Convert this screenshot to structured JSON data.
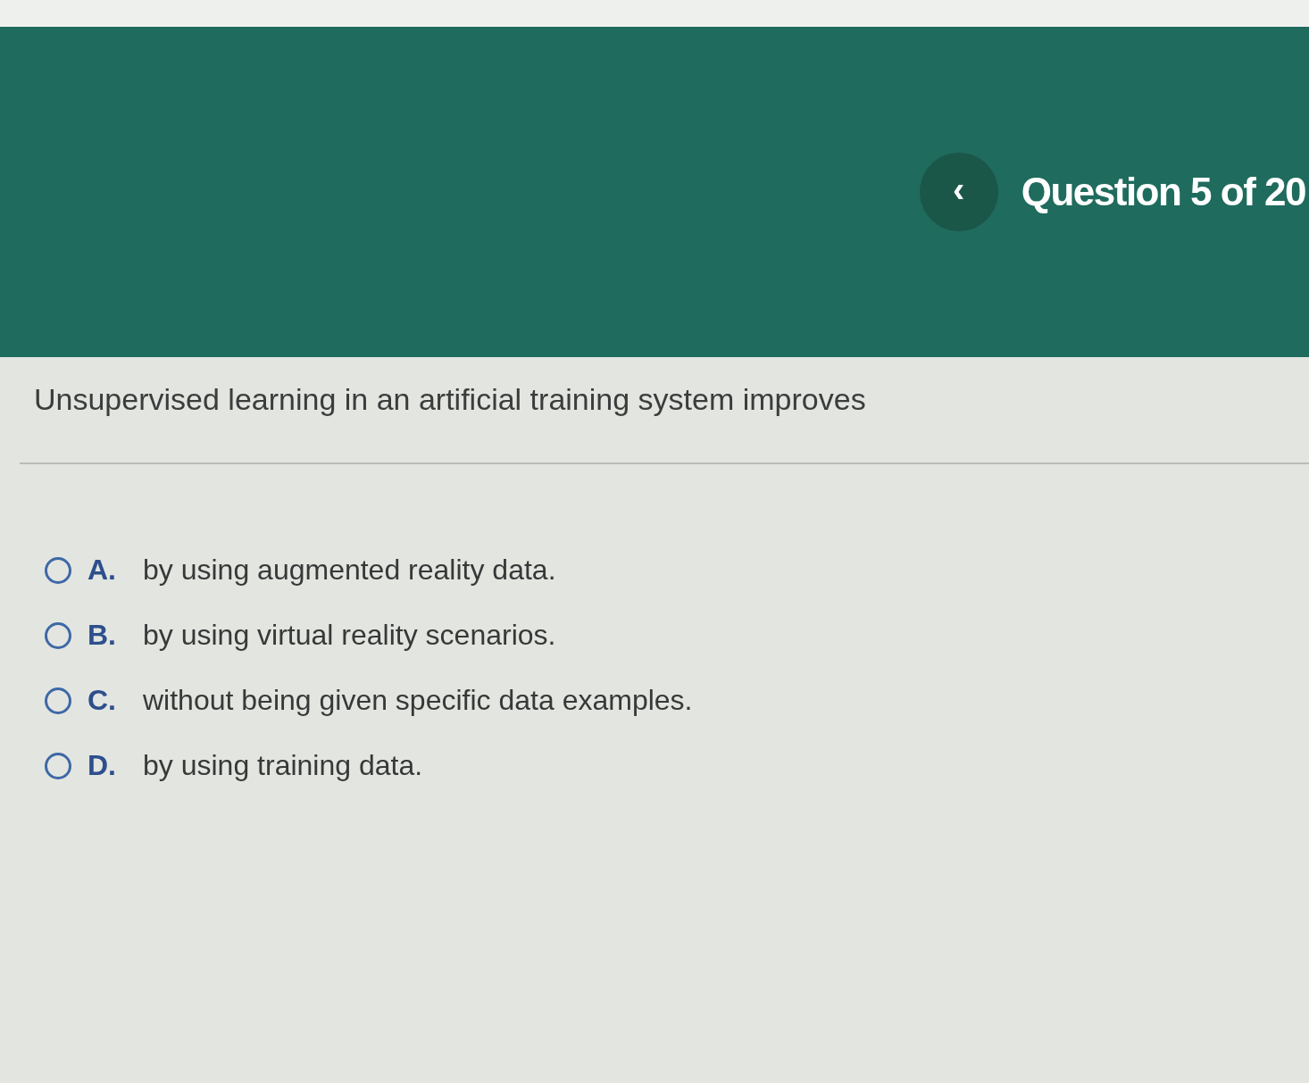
{
  "header": {
    "back_button": "‹",
    "title": "Question 5 of 20"
  },
  "question": "Unsupervised learning in an artificial training system improves",
  "options": [
    {
      "letter": "A.",
      "text": "by using augmented reality data.",
      "selected": false
    },
    {
      "letter": "B.",
      "text": "by using virtual reality scenarios.",
      "selected": false
    },
    {
      "letter": "C.",
      "text": "without being given specific data examples.",
      "selected": false
    },
    {
      "letter": "D.",
      "text": "by using training data.",
      "selected": false
    }
  ]
}
